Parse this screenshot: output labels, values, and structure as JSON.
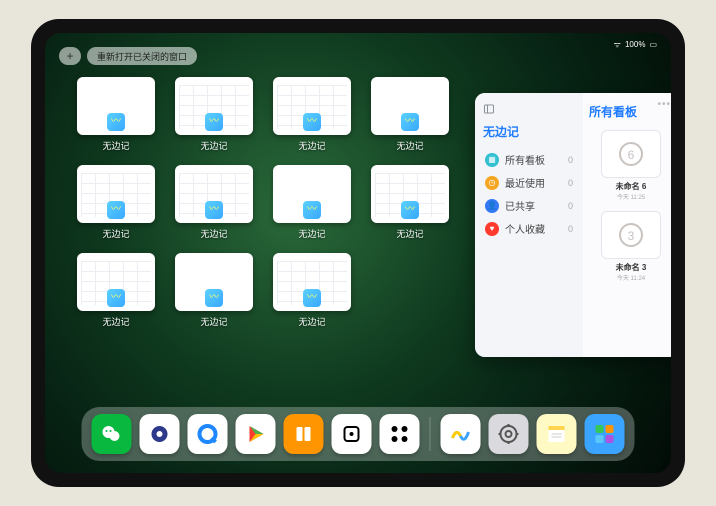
{
  "status": {
    "battery": "100%",
    "wifi": "●"
  },
  "top": {
    "add": "+",
    "reopen_label": "重新打开已关闭的窗口"
  },
  "window_label": "无边记",
  "windows_count": 11,
  "window_variants": [
    "blank",
    "calendarish",
    "calendarish",
    "blank",
    "calendarish",
    "calendarish",
    "blank",
    "calendarish",
    "calendarish",
    "blank",
    "calendarish"
  ],
  "panel": {
    "left_title": "无边记",
    "items": [
      {
        "label": "所有看板",
        "count": "0",
        "color": "#33c0d1",
        "icon": "grid"
      },
      {
        "label": "最近使用",
        "count": "0",
        "color": "#f5a623",
        "icon": "clock"
      },
      {
        "label": "已共享",
        "count": "0",
        "color": "#3478f6",
        "icon": "person"
      },
      {
        "label": "个人收藏",
        "count": "0",
        "color": "#ff3b30",
        "icon": "heart"
      }
    ],
    "right_title": "所有看板",
    "boards": [
      {
        "name": "未命名 6",
        "time": "今天 11:25",
        "digit": "6"
      },
      {
        "name": "未命名 3",
        "time": "今天 11:24",
        "digit": "3"
      }
    ]
  },
  "dock": [
    {
      "name": "wechat",
      "bg": "#09b83e",
      "glyph": "wechat"
    },
    {
      "name": "browser1",
      "bg": "#ffffff",
      "glyph": "ring-blue"
    },
    {
      "name": "browser2",
      "bg": "#ffffff",
      "glyph": "q-blue"
    },
    {
      "name": "play",
      "bg": "#ffffff",
      "glyph": "play"
    },
    {
      "name": "books",
      "bg": "#ff9500",
      "glyph": "books"
    },
    {
      "name": "dice",
      "bg": "#ffffff",
      "glyph": "square-dot"
    },
    {
      "name": "nodes",
      "bg": "#ffffff",
      "glyph": "nodes"
    },
    {
      "name": "sep"
    },
    {
      "name": "freeform",
      "bg": "#ffffff",
      "glyph": "freeform"
    },
    {
      "name": "settings",
      "bg": "#d9d9de",
      "glyph": "gear"
    },
    {
      "name": "notes",
      "bg": "#fff9c4",
      "glyph": "notes"
    },
    {
      "name": "folder",
      "bg": "#3aa4ff",
      "glyph": "folder"
    }
  ]
}
